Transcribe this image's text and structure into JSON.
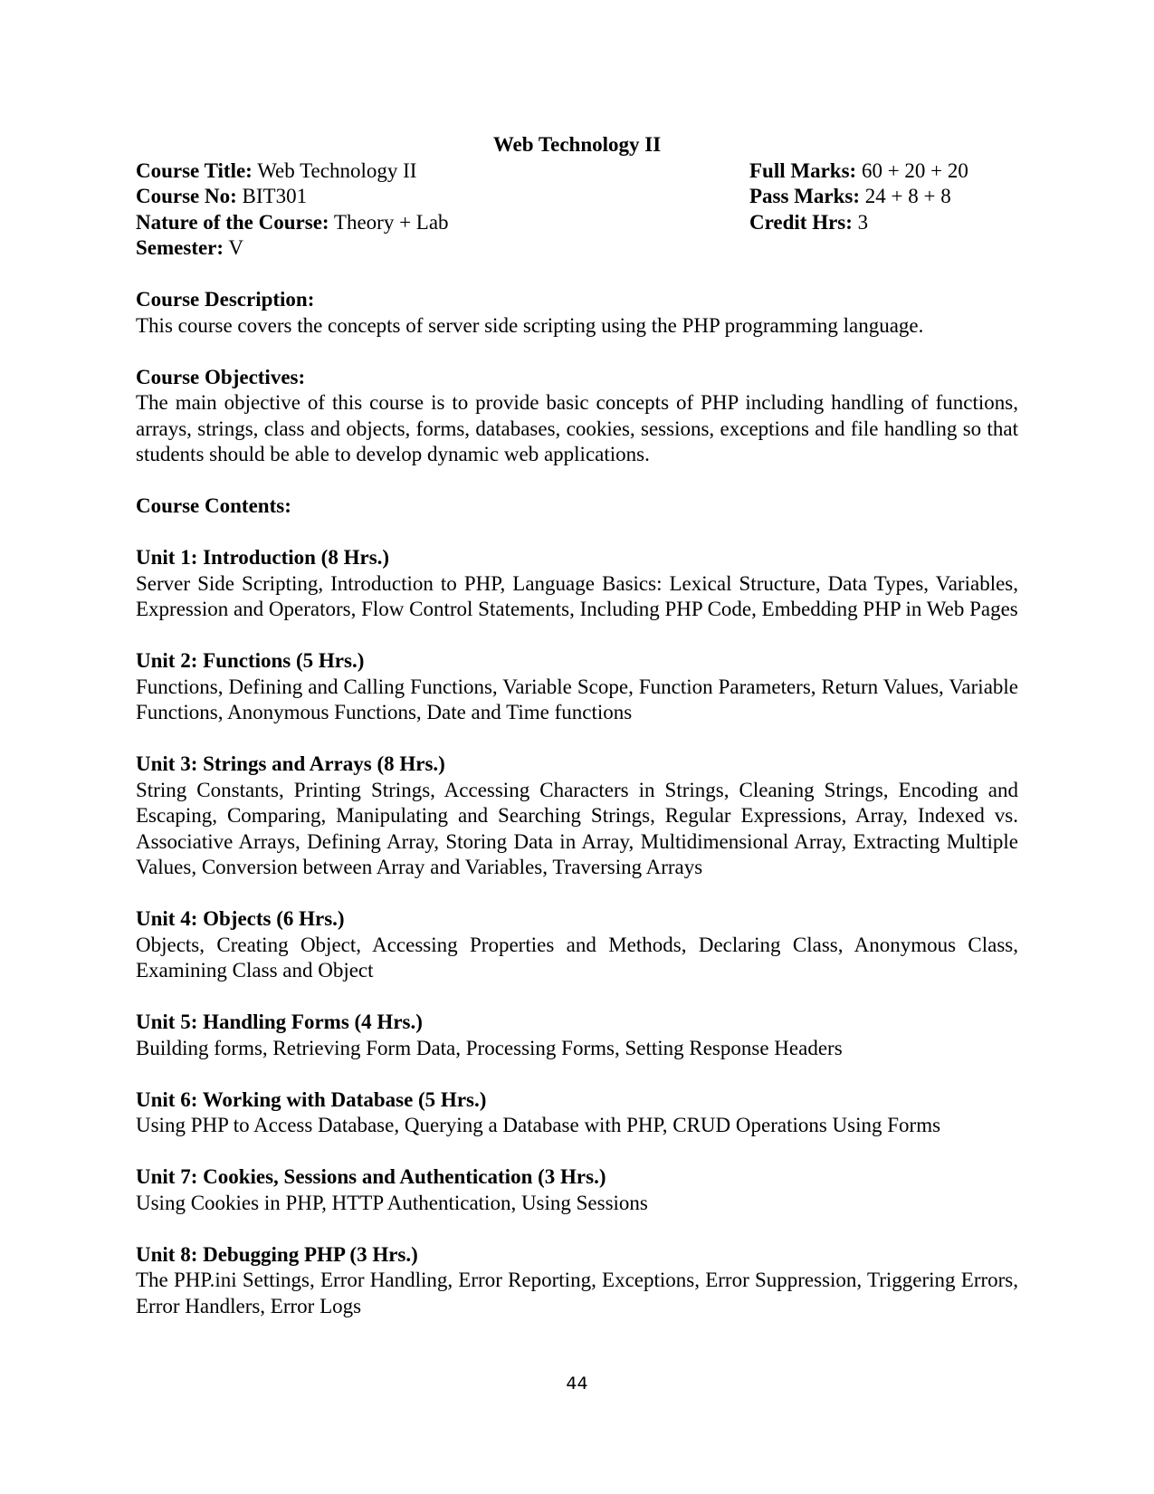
{
  "document": {
    "title": "Web Technology II",
    "header_left": [
      {
        "label": "Course Title:",
        "value": "Web Technology II"
      },
      {
        "label": "Course No:",
        "value": "BIT301"
      },
      {
        "label": "Nature of the Course:",
        "value": "Theory + Lab"
      },
      {
        "label": "Semester:",
        "value": "V"
      }
    ],
    "header_right": [
      {
        "label": "Full Marks:",
        "value": "60 + 20 + 20"
      },
      {
        "label": "Pass Marks:",
        "value": "24 + 8 + 8"
      },
      {
        "label": "Credit Hrs:",
        "value": "3"
      }
    ],
    "description": {
      "heading": "Course Description:",
      "body": "This course covers the concepts of server side scripting using the PHP programming language."
    },
    "objectives": {
      "heading": "Course Objectives:",
      "body": "The main objective of this course is to provide basic concepts of PHP including handling of functions, arrays, strings, class and objects, forms, databases, cookies, sessions, exceptions and file handling so that students should be able to develop dynamic web applications."
    },
    "contents_heading": "Course Contents:",
    "units": [
      {
        "heading": "Unit 1: Introduction (8 Hrs.)",
        "body": "Server Side Scripting, Introduction to PHP, Language Basics: Lexical Structure, Data Types, Variables, Expression and Operators, Flow Control Statements, Including PHP Code, Embedding PHP in Web Pages"
      },
      {
        "heading": "Unit 2: Functions (5 Hrs.)",
        "body": "Functions, Defining and Calling Functions, Variable Scope, Function Parameters, Return Values, Variable Functions, Anonymous Functions, Date and Time functions"
      },
      {
        "heading": "Unit 3: Strings and Arrays (8 Hrs.)",
        "body": "String Constants, Printing Strings, Accessing Characters in Strings, Cleaning Strings, Encoding and Escaping, Comparing, Manipulating and Searching Strings, Regular Expressions, Array, Indexed vs. Associative Arrays, Defining Array, Storing Data in Array, Multidimensional Array, Extracting Multiple Values, Conversion between Array and Variables, Traversing Arrays"
      },
      {
        "heading": "Unit 4: Objects (6 Hrs.)",
        "body": "Objects, Creating Object, Accessing Properties and Methods, Declaring Class, Anonymous Class, Examining Class and Object"
      },
      {
        "heading": "Unit 5: Handling Forms (4 Hrs.)",
        "body": "Building forms, Retrieving Form Data, Processing Forms, Setting Response Headers"
      },
      {
        "heading": "Unit 6: Working with Database (5 Hrs.)",
        "body": "Using PHP to Access Database, Querying a Database with PHP, CRUD Operations Using Forms"
      },
      {
        "heading": "Unit 7: Cookies, Sessions and Authentication (3 Hrs.)",
        "body": "Using Cookies in PHP, HTTP Authentication, Using Sessions"
      },
      {
        "heading": "Unit 8: Debugging PHP (3 Hrs.)",
        "body": "The PHP.ini Settings, Error Handling, Error Reporting, Exceptions, Error Suppression, Triggering Errors, Error Handlers, Error Logs"
      }
    ],
    "page_number": "44"
  }
}
